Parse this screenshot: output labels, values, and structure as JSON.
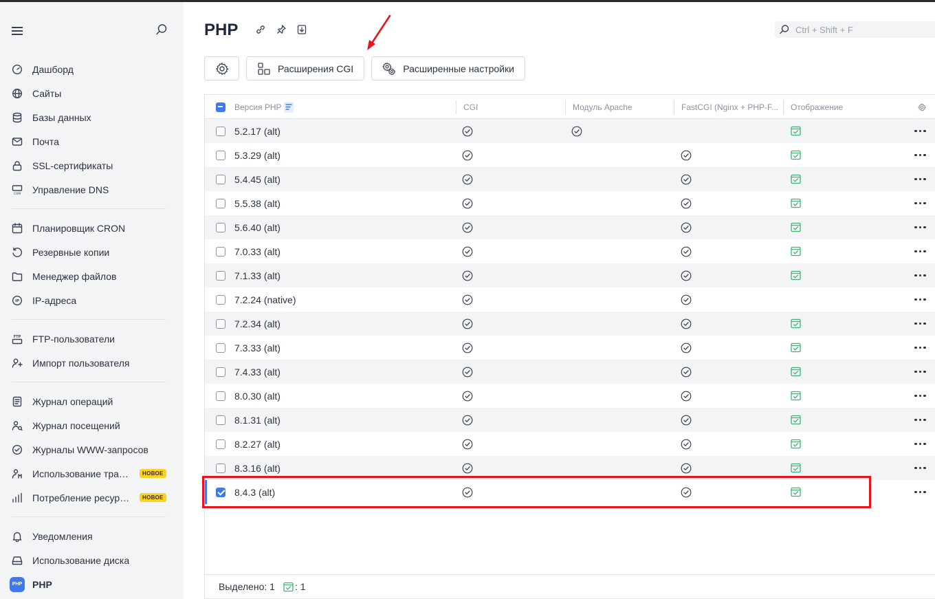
{
  "sidebar": {
    "groups": [
      [
        {
          "label": "Дашборд",
          "icon": "dashboard-icon"
        },
        {
          "label": "Сайты",
          "icon": "globe-icon"
        },
        {
          "label": "Базы данных",
          "icon": "database-icon"
        },
        {
          "label": "Почта",
          "icon": "mail-icon"
        },
        {
          "label": "SSL-сертификаты",
          "icon": "lock-icon"
        },
        {
          "label": "Управление DNS",
          "icon": "dns-icon"
        }
      ],
      [
        {
          "label": "Планировщик CRON",
          "icon": "calendar-icon"
        },
        {
          "label": "Резервные копии",
          "icon": "backup-icon"
        },
        {
          "label": "Менеджер файлов",
          "icon": "folder-icon"
        },
        {
          "label": "IP-адреса",
          "icon": "ip-icon"
        }
      ],
      [
        {
          "label": "FTP-пользователи",
          "icon": "ftp-icon"
        },
        {
          "label": "Импорт пользователя",
          "icon": "import-user-icon"
        }
      ],
      [
        {
          "label": "Журнал операций",
          "icon": "journal-icon"
        },
        {
          "label": "Журнал посещений",
          "icon": "visits-icon"
        },
        {
          "label": "Журналы WWW-запросов",
          "icon": "www-log-icon"
        },
        {
          "label": "Использование трафика",
          "icon": "traffic-icon",
          "badge": "НОВОЕ"
        },
        {
          "label": "Потребление ресурсов",
          "icon": "resources-icon",
          "badge": "НОВОЕ"
        }
      ],
      [
        {
          "label": "Уведомления",
          "icon": "bell-icon"
        },
        {
          "label": "Использование диска",
          "icon": "disk-icon"
        },
        {
          "label": "PHP",
          "icon": "php-icon",
          "icon_text": "PHP",
          "active": true
        }
      ]
    ]
  },
  "header": {
    "title": "PHP",
    "search_placeholder": "Ctrl + Shift + F"
  },
  "toolbar": {
    "cgi_extensions": "Расширения CGI",
    "advanced_settings": "Расширенные настройки"
  },
  "table": {
    "columns": {
      "version": "Версия PHP",
      "cgi": "CGI",
      "apache": "Модуль Apache",
      "fastcgi": "FastCGI (Nginx + PHP-F...",
      "display": "Отображение"
    },
    "rows": [
      {
        "version": "5.2.17 (alt)",
        "cgi": true,
        "apache": true,
        "fastcgi": false,
        "display": true,
        "checked": false
      },
      {
        "version": "5.3.29 (alt)",
        "cgi": true,
        "apache": false,
        "fastcgi": true,
        "display": true,
        "checked": false
      },
      {
        "version": "5.4.45 (alt)",
        "cgi": true,
        "apache": false,
        "fastcgi": true,
        "display": true,
        "checked": false
      },
      {
        "version": "5.5.38 (alt)",
        "cgi": true,
        "apache": false,
        "fastcgi": true,
        "display": true,
        "checked": false
      },
      {
        "version": "5.6.40 (alt)",
        "cgi": true,
        "apache": false,
        "fastcgi": true,
        "display": true,
        "checked": false
      },
      {
        "version": "7.0.33 (alt)",
        "cgi": true,
        "apache": false,
        "fastcgi": true,
        "display": true,
        "checked": false
      },
      {
        "version": "7.1.33 (alt)",
        "cgi": true,
        "apache": false,
        "fastcgi": true,
        "display": true,
        "checked": false
      },
      {
        "version": "7.2.24 (native)",
        "cgi": true,
        "apache": false,
        "fastcgi": true,
        "display": false,
        "checked": false
      },
      {
        "version": "7.2.34 (alt)",
        "cgi": true,
        "apache": false,
        "fastcgi": true,
        "display": true,
        "checked": false
      },
      {
        "version": "7.3.33 (alt)",
        "cgi": true,
        "apache": false,
        "fastcgi": true,
        "display": true,
        "checked": false
      },
      {
        "version": "7.4.33 (alt)",
        "cgi": true,
        "apache": false,
        "fastcgi": true,
        "display": true,
        "checked": false
      },
      {
        "version": "8.0.30 (alt)",
        "cgi": true,
        "apache": false,
        "fastcgi": true,
        "display": true,
        "checked": false
      },
      {
        "version": "8.1.31 (alt)",
        "cgi": true,
        "apache": false,
        "fastcgi": true,
        "display": true,
        "checked": false
      },
      {
        "version": "8.2.27 (alt)",
        "cgi": true,
        "apache": false,
        "fastcgi": true,
        "display": true,
        "checked": false
      },
      {
        "version": "8.3.16 (alt)",
        "cgi": true,
        "apache": false,
        "fastcgi": true,
        "display": true,
        "checked": false
      },
      {
        "version": "8.4.3 (alt)",
        "cgi": true,
        "apache": false,
        "fastcgi": true,
        "display": true,
        "checked": true
      }
    ]
  },
  "footer": {
    "selected_label": "Выделено: 1",
    "display_count": ": 1"
  },
  "colors": {
    "accent": "#3d7af0",
    "success": "#3cb371",
    "highlight": "#e8131b",
    "badge": "#ffd21f"
  }
}
